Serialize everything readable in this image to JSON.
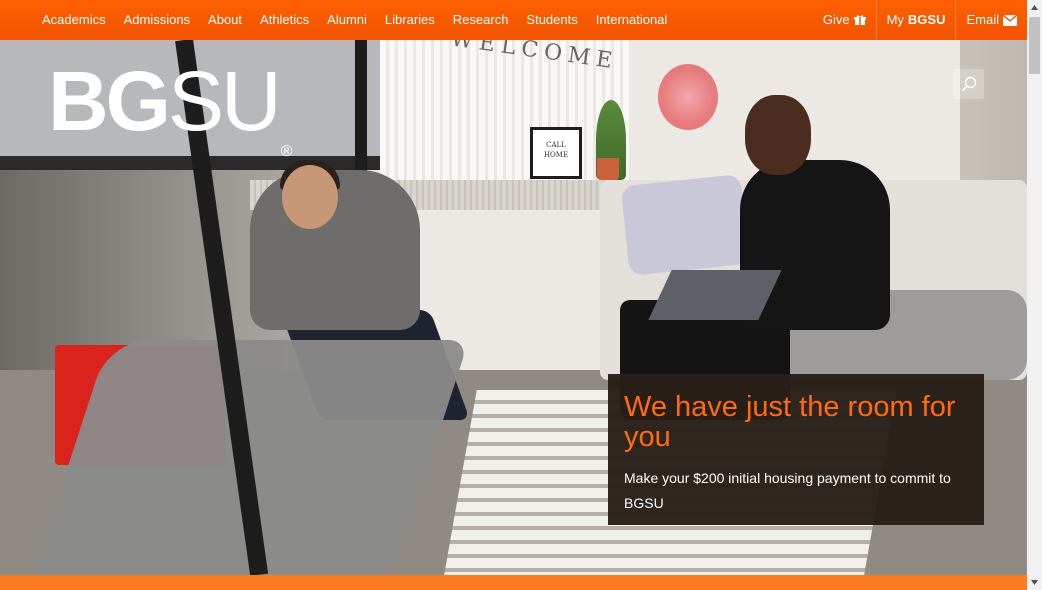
{
  "nav": {
    "links": [
      "Academics",
      "Admissions",
      "About",
      "Athletics",
      "Alumni",
      "Libraries",
      "Research",
      "Students",
      "International"
    ],
    "give_label": "Give",
    "give_icon": "gift-icon",
    "my_prefix": "My",
    "my_bold": "BGSU",
    "email_label": "Email",
    "email_icon": "envelope-icon",
    "background_color": "#fd5f00"
  },
  "logo": {
    "bold_part": "BG",
    "light_part": "SU",
    "registered": "®"
  },
  "hero": {
    "image_sign": "WELCOME",
    "frame_text": "CALL HOME",
    "search_icon": "search-icon",
    "callout_title": "We have just the room for you",
    "callout_text": "Make your $200 initial housing payment to commit to BGSU",
    "accent_color": "#ff6a12",
    "callout_bg": "#281f19"
  },
  "footer_bar_color": "#fd7a20"
}
